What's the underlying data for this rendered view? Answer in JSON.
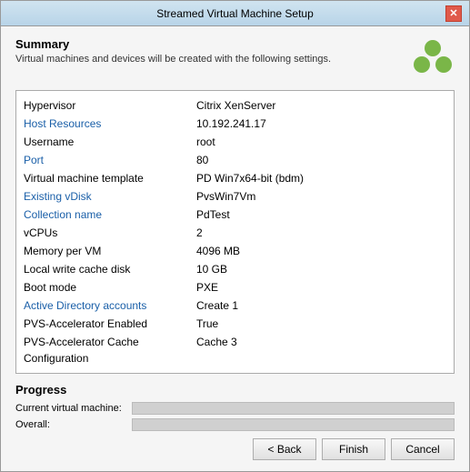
{
  "window": {
    "title": "Streamed Virtual Machine Setup",
    "close_label": "✕"
  },
  "summary": {
    "title": "Summary",
    "description": "Virtual machines and devices will be created with the following settings."
  },
  "info_rows": [
    {
      "label": "Hypervisor",
      "value": "Citrix XenServer",
      "blue": false
    },
    {
      "label": "Host Resources",
      "value": "10.192.241.17",
      "blue": true
    },
    {
      "label": "Username",
      "value": "root",
      "blue": false
    },
    {
      "label": "Port",
      "value": "80",
      "blue": true
    },
    {
      "label": "Virtual machine template",
      "value": "PD Win7x64-bit (bdm)",
      "blue": false
    },
    {
      "label": "Existing vDisk",
      "value": "PvsWin7Vm",
      "blue": true
    },
    {
      "label": "Collection name",
      "value": "PdTest",
      "blue": true
    },
    {
      "label": "vCPUs",
      "value": "2",
      "blue": false
    },
    {
      "label": "Memory per VM",
      "value": "4096 MB",
      "blue": false
    },
    {
      "label": "Local write cache disk",
      "value": "10 GB",
      "blue": false
    },
    {
      "label": "Boot mode",
      "value": "PXE",
      "blue": false
    },
    {
      "label": "Active Directory accounts",
      "value": "Create 1",
      "blue": true
    },
    {
      "label": "PVS-Accelerator Enabled",
      "value": "True",
      "blue": false
    },
    {
      "label": "PVS-Accelerator Cache Configuration",
      "value": "Cache 3",
      "blue": false
    }
  ],
  "progress": {
    "title": "Progress",
    "current_label": "Current virtual machine:",
    "overall_label": "Overall:"
  },
  "buttons": {
    "back": "< Back",
    "finish": "Finish",
    "cancel": "Cancel"
  }
}
